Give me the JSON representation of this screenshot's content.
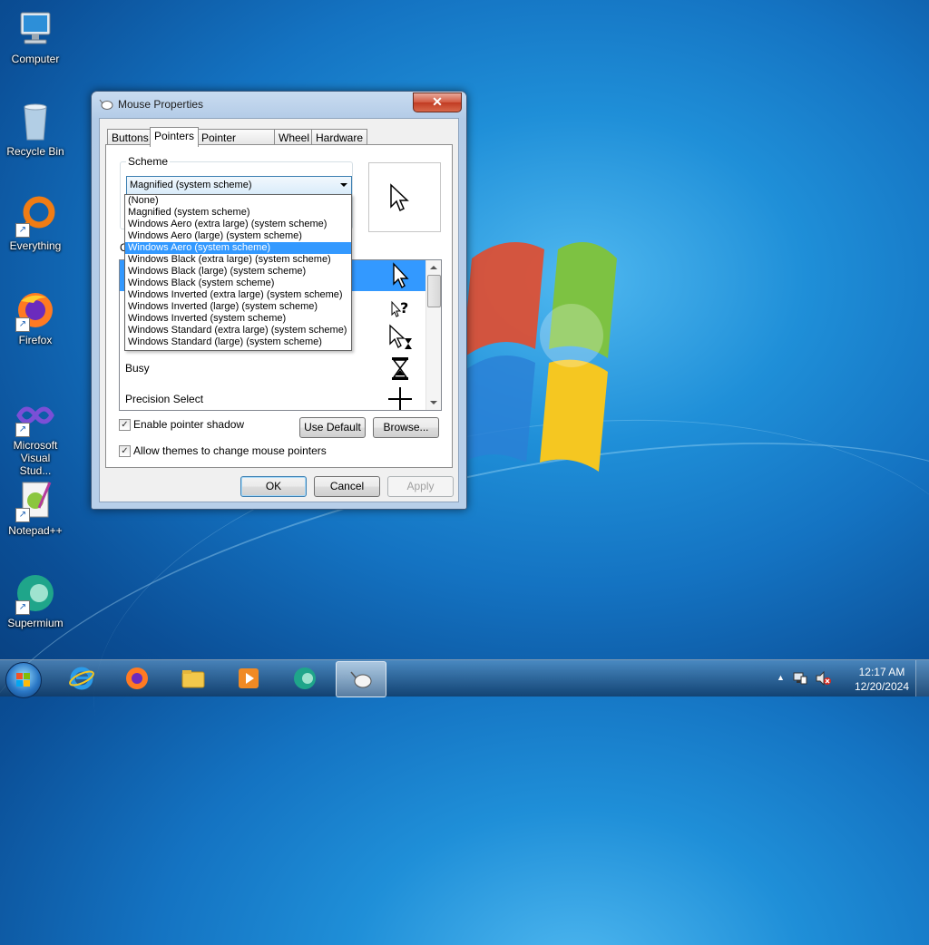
{
  "desktop": {
    "icons": [
      {
        "label": "Computer",
        "icon": "computer-icon"
      },
      {
        "label": "Recycle Bin",
        "icon": "recycle-bin-icon"
      },
      {
        "label": "Everything",
        "icon": "everything-icon"
      },
      {
        "label": "Firefox",
        "icon": "firefox-icon"
      },
      {
        "label": "Microsoft Visual Stud...",
        "icon": "visual-studio-icon"
      },
      {
        "label": "Notepad++",
        "icon": "notepadpp-icon"
      },
      {
        "label": "Supermium",
        "icon": "supermium-icon"
      }
    ]
  },
  "dialog": {
    "title": "Mouse Properties",
    "close_label": "✕",
    "tabs": [
      {
        "label": "Buttons"
      },
      {
        "label": "Pointers"
      },
      {
        "label": "Pointer Options"
      },
      {
        "label": "Wheel"
      },
      {
        "label": "Hardware"
      }
    ],
    "active_tab": "Pointers",
    "scheme_label": "Scheme",
    "scheme_selected": "Magnified (system scheme)",
    "scheme_options": [
      "(None)",
      "Magnified (system scheme)",
      "Windows Aero (extra large) (system scheme)",
      "Windows Aero (large) (system scheme)",
      "Windows Aero (system scheme)",
      "Windows Black (extra large) (system scheme)",
      "Windows Black (large) (system scheme)",
      "Windows Black (system scheme)",
      "Windows Inverted (extra large) (system scheme)",
      "Windows Inverted (large) (system scheme)",
      "Windows Inverted (system scheme)",
      "Windows Standard (extra large) (system scheme)",
      "Windows Standard (large) (system scheme)"
    ],
    "highlighted_option": "Windows Aero (system scheme)",
    "customize_label": "Cu",
    "cursor_rows": [
      {
        "name": "",
        "icon": "arrow-cursor-icon",
        "selected": true
      },
      {
        "name": "",
        "icon": "help-select-cursor-icon",
        "selected": false
      },
      {
        "name": "",
        "icon": "working-in-background-cursor-icon",
        "selected": false
      },
      {
        "name": "Busy",
        "icon": "hourglass-cursor-icon",
        "selected": false
      },
      {
        "name": "Precision Select",
        "icon": "crosshair-cursor-icon",
        "selected": false
      }
    ],
    "enable_shadow_label": "Enable pointer shadow",
    "enable_shadow_checked": true,
    "allow_themes_label": "Allow themes to change mouse pointers",
    "allow_themes_checked": true,
    "use_default_label": "Use Default",
    "browse_label": "Browse...",
    "ok_label": "OK",
    "cancel_label": "Cancel",
    "apply_label": "Apply"
  },
  "taskbar": {
    "pinned": [
      {
        "icon": "internet-explorer-icon"
      },
      {
        "icon": "firefox-icon"
      },
      {
        "icon": "file-explorer-icon"
      },
      {
        "icon": "media-player-icon"
      },
      {
        "icon": "supermium-icon"
      },
      {
        "icon": "mouse-properties-icon",
        "active": true
      }
    ],
    "tray_icons": [
      "show-hidden-icons-icon",
      "network-icon",
      "volume-muted-icon"
    ],
    "time": "12:17 AM",
    "date": "12/20/2024"
  }
}
